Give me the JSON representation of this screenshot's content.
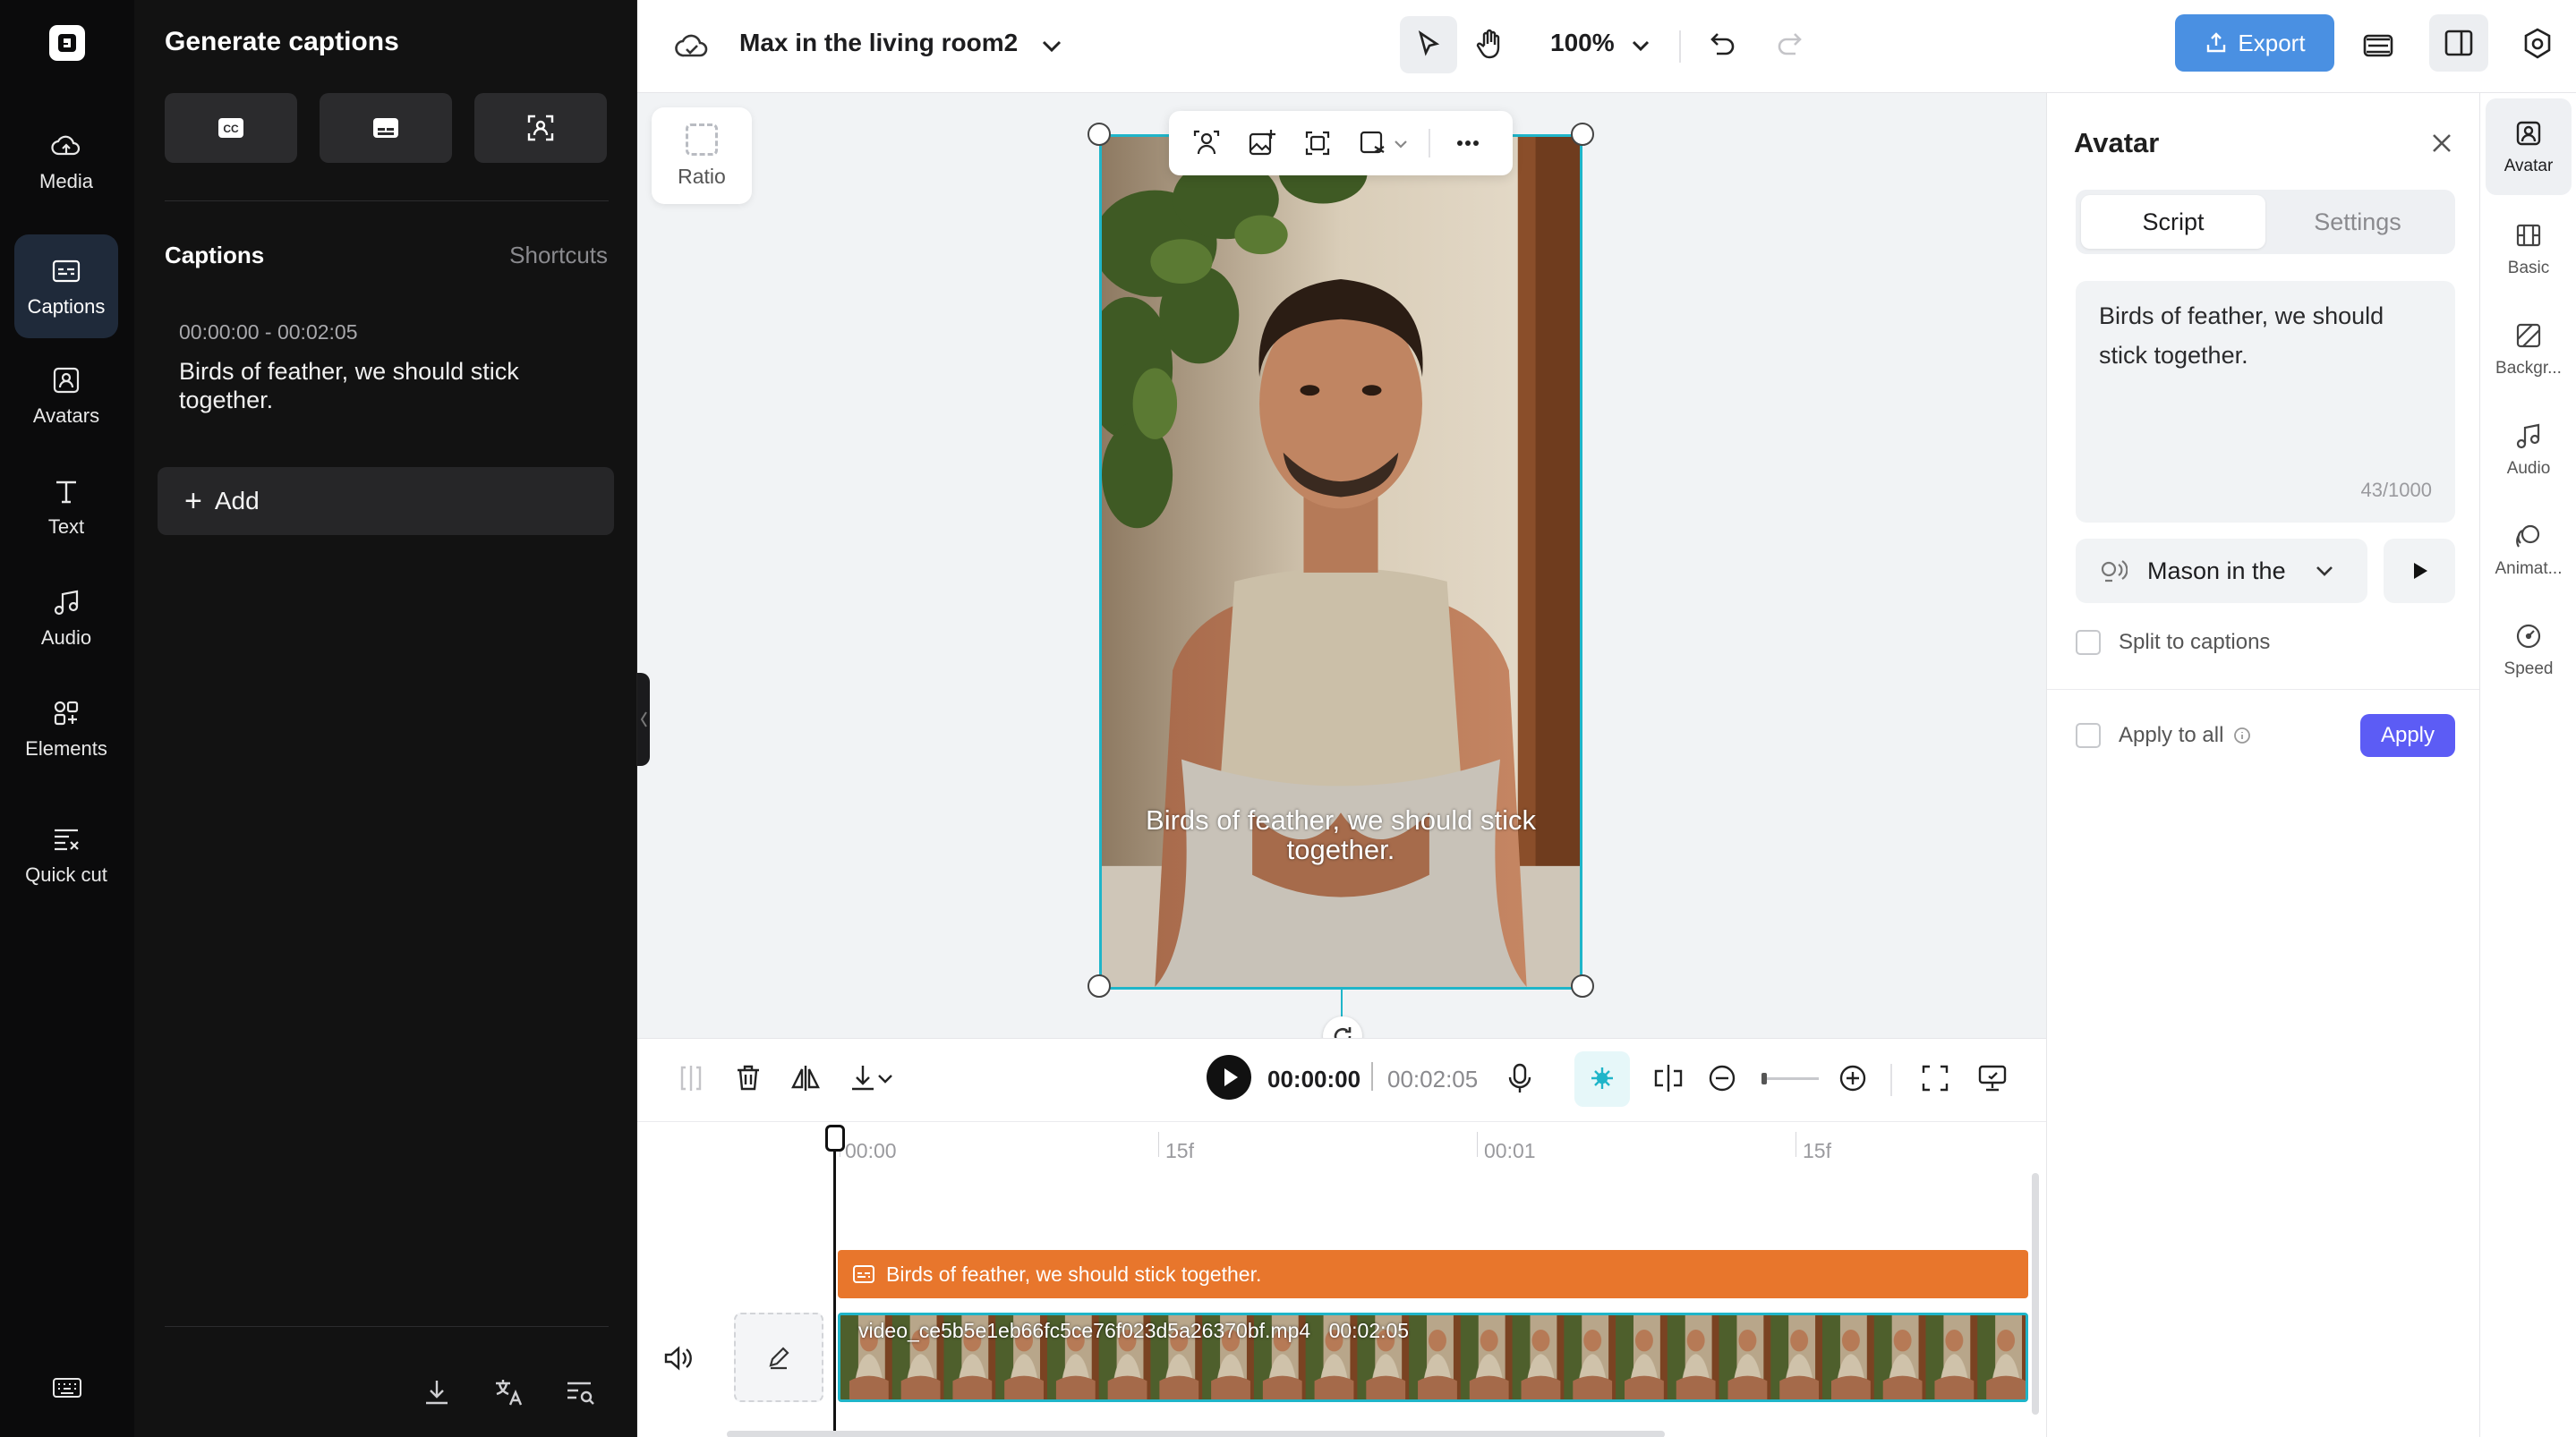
{
  "rail": {
    "items": [
      {
        "label": "Media",
        "icon": "cloud-upload-icon"
      },
      {
        "label": "Captions",
        "icon": "captions-icon",
        "active": true
      },
      {
        "label": "Avatars",
        "icon": "avatar-icon"
      },
      {
        "label": "Text",
        "icon": "text-icon"
      },
      {
        "label": "Audio",
        "icon": "music-note-icon"
      },
      {
        "label": "Elements",
        "icon": "elements-icon"
      },
      {
        "label": "Quick cut",
        "icon": "quick-cut-icon"
      }
    ]
  },
  "captions_panel": {
    "title": "Generate captions",
    "section_title": "Captions",
    "shortcuts_label": "Shortcuts",
    "items": [
      {
        "time": "00:00:00 - 00:02:05",
        "text": "Birds of feather, we should stick together."
      }
    ],
    "add_label": "Add"
  },
  "topbar": {
    "project_name": "Max in the living room2",
    "zoom": "100%",
    "export_label": "Export"
  },
  "canvas": {
    "ratio_label": "Ratio",
    "overlay_caption": "Birds of feather, we should stick together."
  },
  "properties": {
    "title": "Avatar",
    "tabs": [
      "Script",
      "Settings"
    ],
    "active_tab": "Script",
    "script_text": "Birds of feather, we should stick together.",
    "char_count": "43/1000",
    "voice": "Mason in the",
    "split_label": "Split to captions",
    "apply_all_label": "Apply to all",
    "apply_label": "Apply"
  },
  "right_tabs": [
    {
      "label": "Avatar",
      "icon": "avatar-icon",
      "active": true
    },
    {
      "label": "Basic",
      "icon": "basic-icon"
    },
    {
      "label": "Backgr...",
      "icon": "background-icon"
    },
    {
      "label": "Audio",
      "icon": "music-note-icon"
    },
    {
      "label": "Animat...",
      "icon": "animation-icon"
    },
    {
      "label": "Speed",
      "icon": "speed-icon"
    }
  ],
  "timeline": {
    "current_time": "00:00:00",
    "duration": "00:02:05",
    "ruler": [
      "00:00",
      "15f",
      "00:01",
      "15f"
    ],
    "caption_clip": "Birds of feather, we should stick together.",
    "video_clip": "video_ce5b5e1eb66fc5ce76f023d5a26370bf.mp4",
    "video_duration": "00:02:05"
  },
  "colors": {
    "accent": "#1fb5c9",
    "export": "#4a90e2",
    "apply": "#5c5cf5",
    "caption_track": "#e8762c",
    "rail_bg": "#0b0b0c",
    "panel_bg": "#121212"
  }
}
